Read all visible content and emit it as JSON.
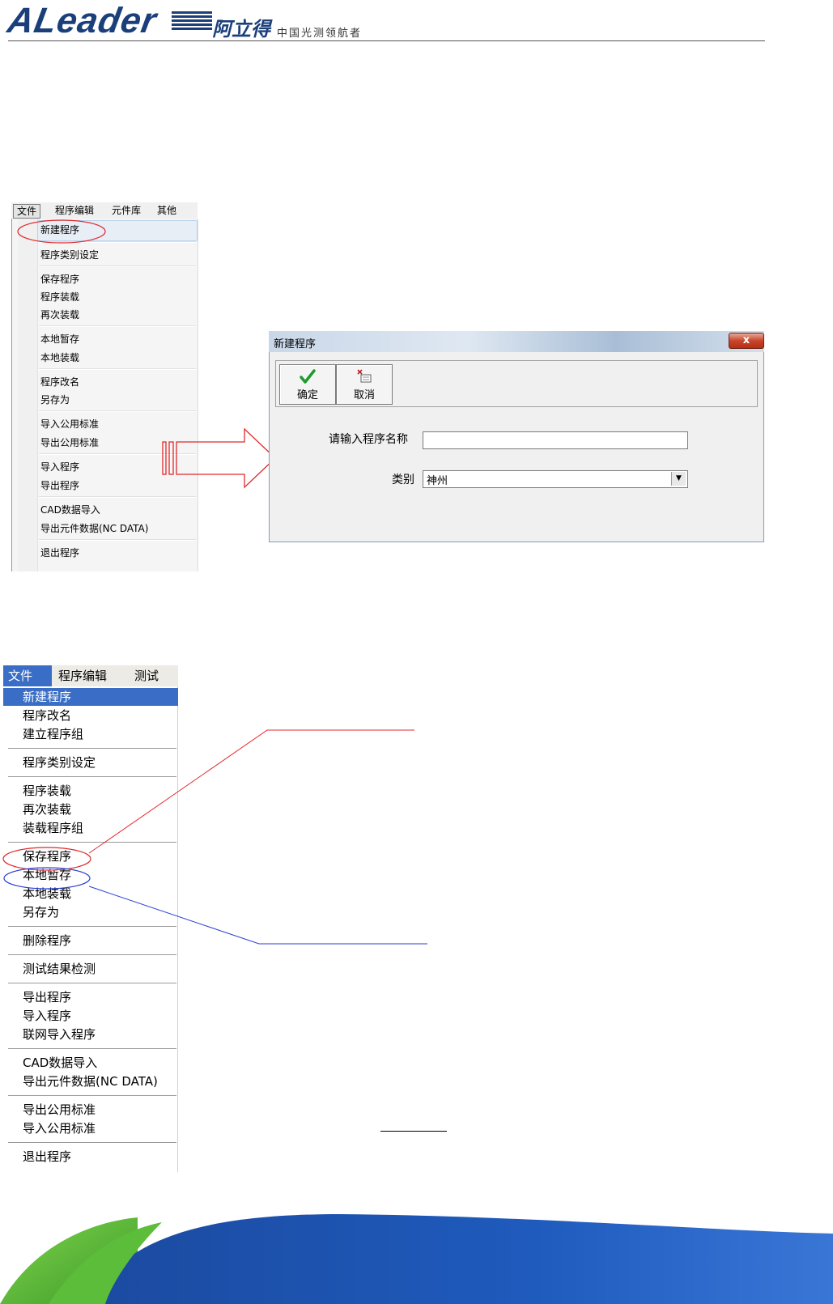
{
  "header": {
    "logo_text": "ALeader",
    "brand_cn": "阿立得",
    "slogan": "中国光测领航者"
  },
  "menu1": {
    "top_menus": [
      "文件",
      "程序编辑",
      "元件库",
      "其他"
    ],
    "items": [
      "新建程序",
      "程序类别设定",
      "保存程序",
      "程序装载",
      "再次装载",
      "本地暂存",
      "本地装载",
      "程序改名",
      "另存为",
      "导入公用标准",
      "导出公用标准",
      "导入程序",
      "导出程序",
      "CAD数据导入",
      "导出元件数据(NC DATA)",
      "退出程序"
    ]
  },
  "dialog": {
    "title": "新建程序",
    "close_label": "x",
    "ok_label": "确定",
    "cancel_label": "取消",
    "name_label": "请输入程序名称",
    "name_value": "",
    "category_label": "类别",
    "category_value": "神州"
  },
  "menu2": {
    "top_menus": [
      "文件",
      "程序编辑",
      "测试"
    ],
    "items": [
      "新建程序",
      "程序改名",
      "建立程序组",
      "程序类别设定",
      "程序装载",
      "再次装载",
      "装载程序组",
      "保存程序",
      "本地暂存",
      "本地装载",
      "另存为",
      "删除程序",
      "测试结果检测",
      "导出程序",
      "导入程序",
      "联网导入程序",
      "CAD数据导入",
      "导出元件数据(NC DATA)",
      "导出公用标准",
      "导入公用标准",
      "退出程序"
    ]
  },
  "colors": {
    "brand": "#1a3f7a",
    "menu_highlight": "#3a6ec6",
    "red_annotation": "#e0282c",
    "blue_annotation": "#2a3fd0"
  }
}
